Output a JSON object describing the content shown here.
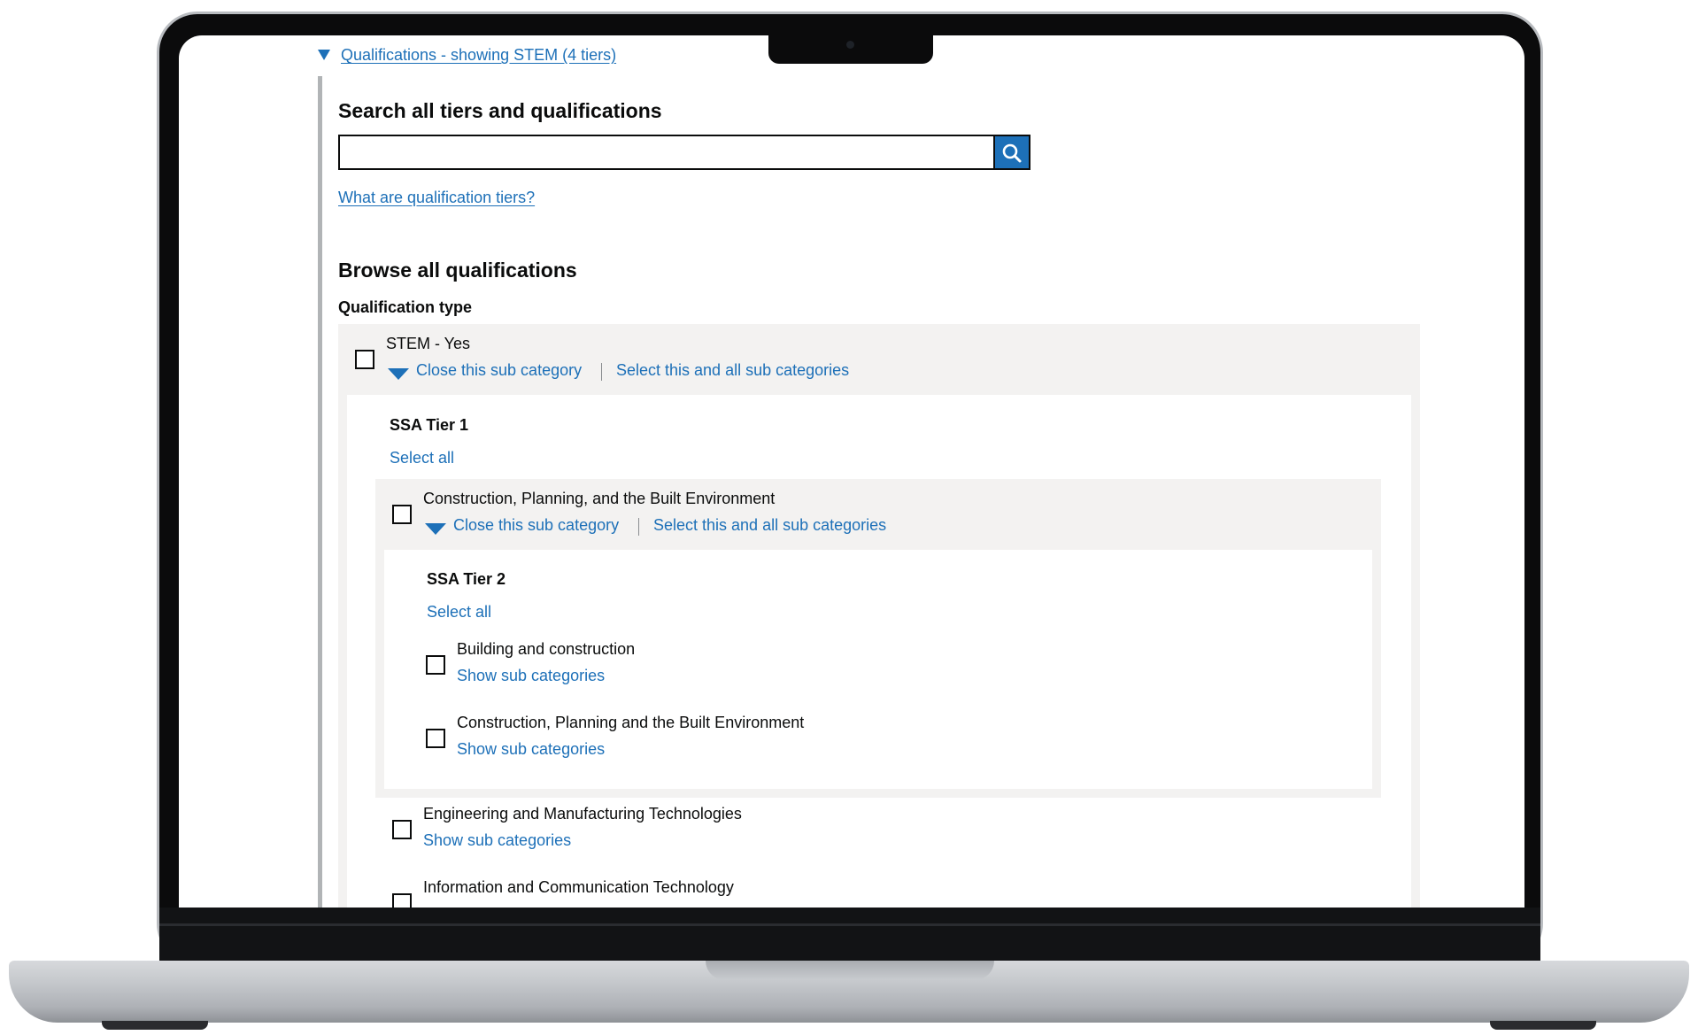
{
  "details": {
    "summary": "Qualifications - showing STEM (4 tiers)"
  },
  "search": {
    "heading": "Search all tiers and qualifications",
    "input_value": "",
    "button_icon": "search-icon",
    "help_link": "What are qualification tiers?"
  },
  "browse": {
    "heading": "Browse all qualifications",
    "legend": "Qualification type",
    "stem": {
      "label": "STEM - Yes",
      "close_link": "Close this sub category",
      "select_all_sub_link": "Select this and all sub categories",
      "tier1": {
        "heading": "SSA Tier 1",
        "select_all": "Select all",
        "construction": {
          "label": "Construction, Planning, and the Built Environment",
          "close_link": "Close this sub category",
          "select_all_sub_link": "Select this and all sub categories",
          "tier2": {
            "heading": "SSA Tier 2",
            "select_all": "Select all",
            "items": [
              {
                "label": "Building and construction",
                "link": "Show sub categories"
              },
              {
                "label": "Construction, Planning and the Built Environment",
                "link": "Show sub categories"
              }
            ]
          }
        },
        "items": [
          {
            "label": "Engineering and Manufacturing Technologies",
            "link": "Show sub categories"
          },
          {
            "label": "Information and Communication Technology"
          }
        ]
      }
    }
  },
  "colors": {
    "link": "#1d70b8",
    "text": "#0b0c0c",
    "panel": "#f3f2f1",
    "border": "#b1b4b6"
  }
}
